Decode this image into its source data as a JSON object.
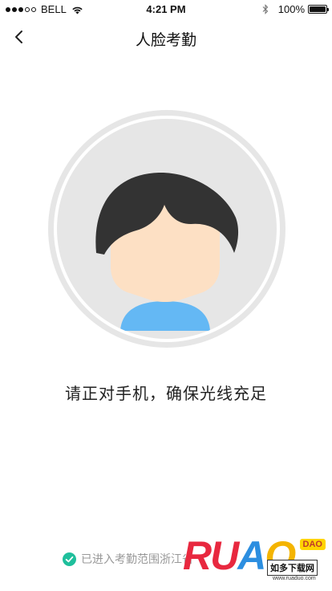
{
  "status_bar": {
    "carrier": "BELL",
    "time": "4:21 PM",
    "battery": "100%",
    "battery_level": 1.0,
    "signal_dots_filled": 3
  },
  "nav": {
    "title": "人脸考勤",
    "back_icon": "chevron-left-icon"
  },
  "avatar": {
    "icon": "face-avatar-placeholder",
    "hair_color": "#333333",
    "skin_color": "#fde0c4",
    "shirt_color": "#64b8f4",
    "ring_color": "#e6e6e6"
  },
  "instruction": "请正对手机，确保光线充足",
  "range_status": {
    "icon": "check-circle-icon",
    "icon_color": "#1fbf9c",
    "text": "已进入考勤范围浙江省"
  },
  "watermark": {
    "logo_text": "RUAODAO",
    "badge_text": "DAO",
    "site_name": "如多下载网",
    "url": "www.ruaduo.com"
  }
}
